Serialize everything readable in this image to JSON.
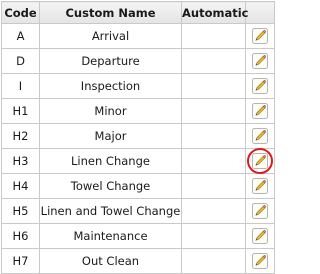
{
  "table": {
    "headers": {
      "code": "Code",
      "custom_name": "Custom Name",
      "automatic": "Automatic",
      "edit": ""
    },
    "rows": [
      {
        "code": "A",
        "name": "Arrival",
        "automatic": "",
        "edit_icon": "pencil-icon",
        "highlighted": false
      },
      {
        "code": "D",
        "name": "Departure",
        "automatic": "",
        "edit_icon": "pencil-icon",
        "highlighted": false
      },
      {
        "code": "I",
        "name": "Inspection",
        "automatic": "",
        "edit_icon": "pencil-icon",
        "highlighted": false
      },
      {
        "code": "H1",
        "name": "Minor",
        "automatic": "",
        "edit_icon": "pencil-icon",
        "highlighted": false
      },
      {
        "code": "H2",
        "name": "Major",
        "automatic": "",
        "edit_icon": "pencil-icon",
        "highlighted": false
      },
      {
        "code": "H3",
        "name": "Linen Change",
        "automatic": "",
        "edit_icon": "pencil-icon",
        "highlighted": true
      },
      {
        "code": "H4",
        "name": "Towel Change",
        "automatic": "",
        "edit_icon": "pencil-icon",
        "highlighted": false
      },
      {
        "code": "H5",
        "name": "Linen and Towel Change",
        "automatic": "",
        "edit_icon": "pencil-icon",
        "highlighted": false
      },
      {
        "code": "H6",
        "name": "Maintenance",
        "automatic": "",
        "edit_icon": "pencil-icon",
        "highlighted": false
      },
      {
        "code": "H7",
        "name": "Out Clean",
        "automatic": "",
        "edit_icon": "pencil-icon",
        "highlighted": false
      }
    ]
  },
  "colors": {
    "highlight_ring": "#e01a1a",
    "border": "#c9c9c9",
    "header_bg": "#e8e8e8"
  }
}
